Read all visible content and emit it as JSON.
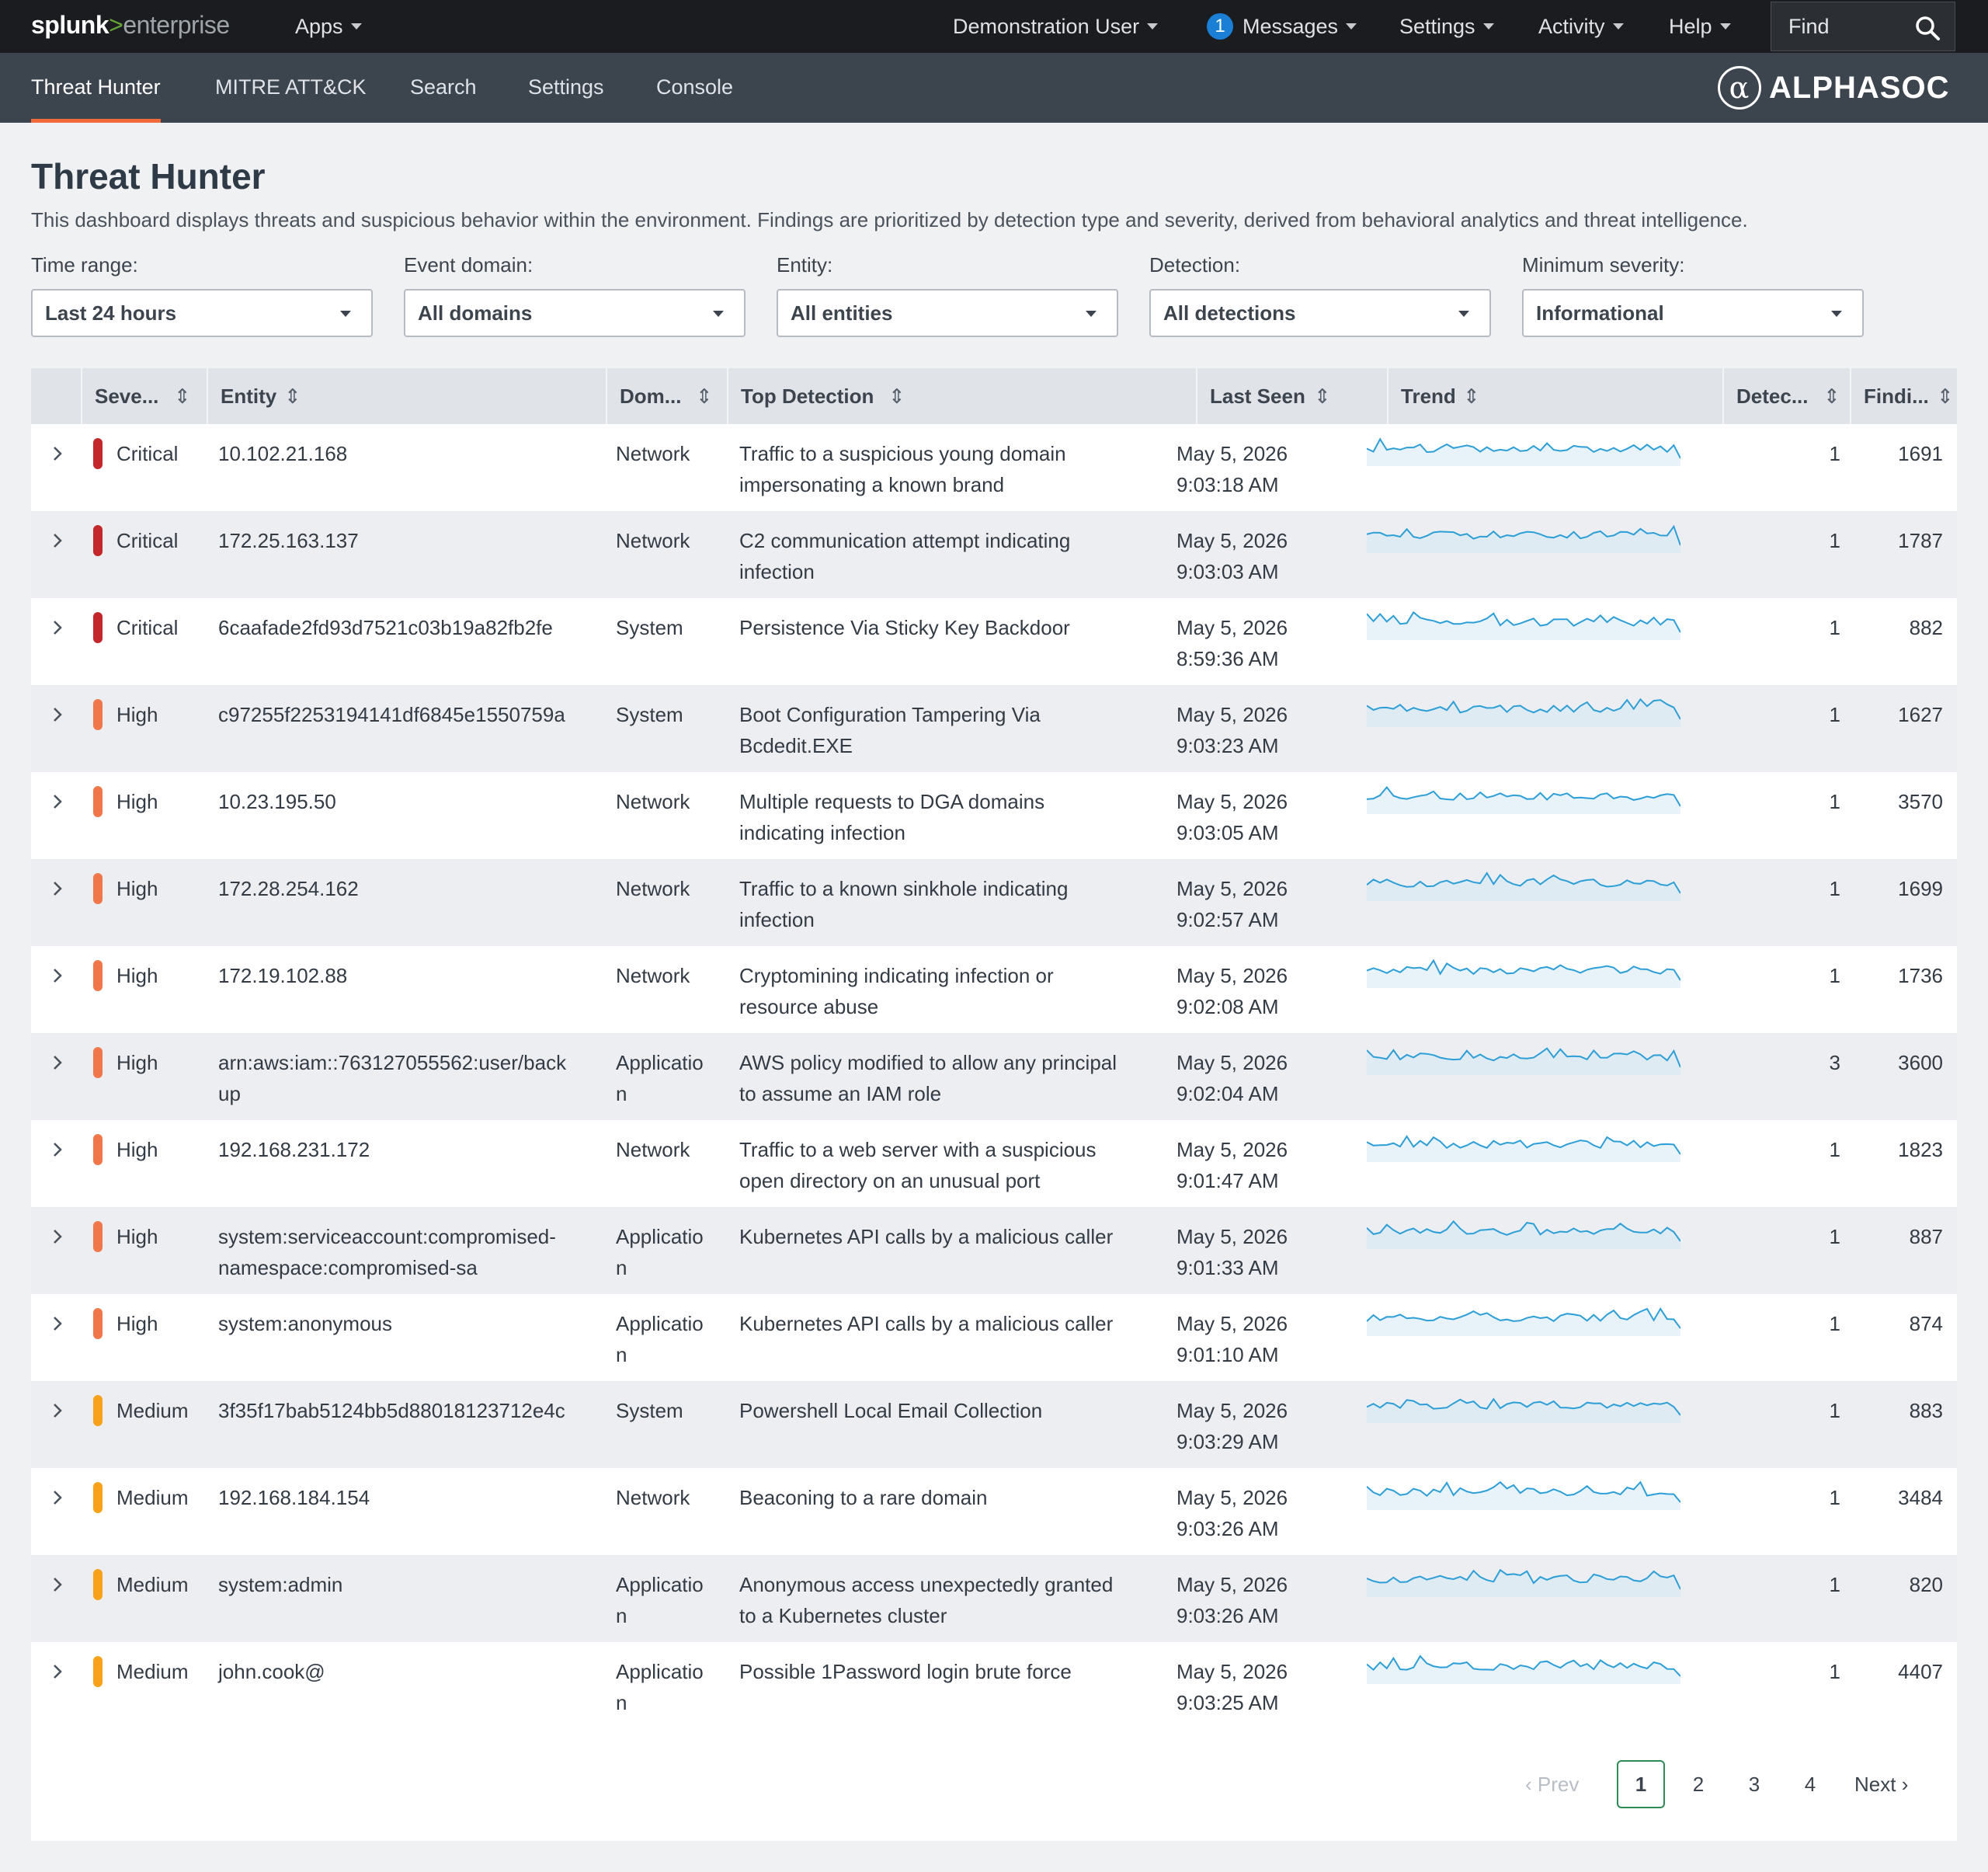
{
  "topbar": {
    "logo": {
      "part1": "splunk",
      "part2": ">",
      "part3": "enterprise"
    },
    "apps_label": "Apps",
    "user_label": "Demonstration User",
    "messages_count": "1",
    "messages_label": "Messages",
    "settings_label": "Settings",
    "activity_label": "Activity",
    "help_label": "Help",
    "find_placeholder": "Find"
  },
  "appbar": {
    "tabs": [
      {
        "label": "Threat Hunter",
        "active": true
      },
      {
        "label": "MITRE ATT&CK"
      },
      {
        "label": "Search"
      },
      {
        "label": "Settings"
      },
      {
        "label": "Console"
      }
    ],
    "brand": "ALPHASOC",
    "brand_symbol": "α"
  },
  "page": {
    "title": "Threat Hunter",
    "description": "This dashboard displays threats and suspicious behavior within the environment. Findings are prioritized by detection type and severity, derived from behavioral analytics and threat intelligence."
  },
  "filters": [
    {
      "label": "Time range:",
      "value": "Last 24 hours"
    },
    {
      "label": "Event domain:",
      "value": "All domains"
    },
    {
      "label": "Entity:",
      "value": "All entities"
    },
    {
      "label": "Detection:",
      "value": "All detections"
    },
    {
      "label": "Minimum severity:",
      "value": "Informational"
    }
  ],
  "colors": {
    "critical": "#c3272b",
    "high": "#f0774a",
    "medium": "#f8a21b",
    "trend": "#2d9fd6",
    "trend_fill": "#d7e9f5"
  },
  "table": {
    "columns": [
      "Seve...",
      "Entity",
      "Dom...",
      "Top Detection",
      "Last Seen",
      "Trend",
      "Detec...",
      "Findi..."
    ],
    "rows": [
      {
        "severity": "Critical",
        "level": "critical",
        "entity": [
          "10.102.21.168"
        ],
        "domain": [
          "Network"
        ],
        "detection": [
          "Traffic to a suspicious young domain",
          "impersonating a known brand"
        ],
        "date": "May 5, 2026",
        "time": "9:03:18 AM",
        "detections": "1",
        "findings": "1691"
      },
      {
        "severity": "Critical",
        "level": "critical",
        "entity": [
          "172.25.163.137"
        ],
        "domain": [
          "Network"
        ],
        "detection": [
          "C2 communication attempt indicating",
          "infection"
        ],
        "date": "May 5, 2026",
        "time": "9:03:03 AM",
        "detections": "1",
        "findings": "1787"
      },
      {
        "severity": "Critical",
        "level": "critical",
        "entity": [
          "6caafade2fd93d7521c03b19a82fb2fe"
        ],
        "domain": [
          "System"
        ],
        "detection": [
          "Persistence Via Sticky Key Backdoor"
        ],
        "date": "May 5, 2026",
        "time": "8:59:36 AM",
        "detections": "1",
        "findings": "882"
      },
      {
        "severity": "High",
        "level": "high",
        "entity": [
          "c97255f2253194141df6845e1550759a"
        ],
        "domain": [
          "System"
        ],
        "detection": [
          "Boot Configuration Tampering Via",
          "Bcdedit.EXE"
        ],
        "date": "May 5, 2026",
        "time": "9:03:23 AM",
        "detections": "1",
        "findings": "1627"
      },
      {
        "severity": "High",
        "level": "high",
        "entity": [
          "10.23.195.50"
        ],
        "domain": [
          "Network"
        ],
        "detection": [
          "Multiple requests to DGA domains",
          "indicating infection"
        ],
        "date": "May 5, 2026",
        "time": "9:03:05 AM",
        "detections": "1",
        "findings": "3570"
      },
      {
        "severity": "High",
        "level": "high",
        "entity": [
          "172.28.254.162"
        ],
        "domain": [
          "Network"
        ],
        "detection": [
          "Traffic to a known sinkhole indicating",
          "infection"
        ],
        "date": "May 5, 2026",
        "time": "9:02:57 AM",
        "detections": "1",
        "findings": "1699"
      },
      {
        "severity": "High",
        "level": "high",
        "entity": [
          "172.19.102.88"
        ],
        "domain": [
          "Network"
        ],
        "detection": [
          "Cryptomining indicating infection or",
          "resource abuse"
        ],
        "date": "May 5, 2026",
        "time": "9:02:08 AM",
        "detections": "1",
        "findings": "1736"
      },
      {
        "severity": "High",
        "level": "high",
        "entity": [
          "arn:aws:iam::763127055562:user/back",
          "up"
        ],
        "domain": [
          "Applicatio",
          "n"
        ],
        "detection": [
          "AWS policy modified to allow any principal",
          "to assume an IAM role"
        ],
        "date": "May 5, 2026",
        "time": "9:02:04 AM",
        "detections": "3",
        "findings": "3600"
      },
      {
        "severity": "High",
        "level": "high",
        "entity": [
          "192.168.231.172"
        ],
        "domain": [
          "Network"
        ],
        "detection": [
          "Traffic to a web server with a suspicious",
          "open directory on an unusual port"
        ],
        "date": "May 5, 2026",
        "time": "9:01:47 AM",
        "detections": "1",
        "findings": "1823"
      },
      {
        "severity": "High",
        "level": "high",
        "entity": [
          "system:serviceaccount:compromised-",
          "namespace:compromised-sa"
        ],
        "domain": [
          "Applicatio",
          "n"
        ],
        "detection": [
          "Kubernetes API calls by a malicious caller"
        ],
        "date": "May 5, 2026",
        "time": "9:01:33 AM",
        "detections": "1",
        "findings": "887"
      },
      {
        "severity": "High",
        "level": "high",
        "entity": [
          "system:anonymous"
        ],
        "domain": [
          "Applicatio",
          "n"
        ],
        "detection": [
          "Kubernetes API calls by a malicious caller"
        ],
        "date": "May 5, 2026",
        "time": "9:01:10 AM",
        "detections": "1",
        "findings": "874"
      },
      {
        "severity": "Medium",
        "level": "medium",
        "entity": [
          "3f35f17bab5124bb5d88018123712e4c"
        ],
        "domain": [
          "System"
        ],
        "detection": [
          "Powershell Local Email Collection"
        ],
        "date": "May 5, 2026",
        "time": "9:03:29 AM",
        "detections": "1",
        "findings": "883"
      },
      {
        "severity": "Medium",
        "level": "medium",
        "entity": [
          "192.168.184.154"
        ],
        "domain": [
          "Network"
        ],
        "detection": [
          "Beaconing to a rare domain"
        ],
        "date": "May 5, 2026",
        "time": "9:03:26 AM",
        "detections": "1",
        "findings": "3484"
      },
      {
        "severity": "Medium",
        "level": "medium",
        "entity": [
          "system:admin"
        ],
        "domain": [
          "Applicatio",
          "n"
        ],
        "detection": [
          "Anonymous access unexpectedly granted",
          "to a Kubernetes cluster"
        ],
        "date": "May 5, 2026",
        "time": "9:03:26 AM",
        "detections": "1",
        "findings": "820"
      },
      {
        "severity": "Medium",
        "level": "medium",
        "entity": [
          "john.cook@"
        ],
        "domain": [
          "Applicatio",
          "n"
        ],
        "detection": [
          "Possible 1Password login brute force"
        ],
        "date": "May 5, 2026",
        "time": "9:03:25 AM",
        "detections": "1",
        "findings": "4407"
      }
    ]
  },
  "pagination": {
    "prev": "Prev",
    "pages": [
      "1",
      "2",
      "3",
      "4"
    ],
    "current": "1",
    "next": "Next"
  }
}
